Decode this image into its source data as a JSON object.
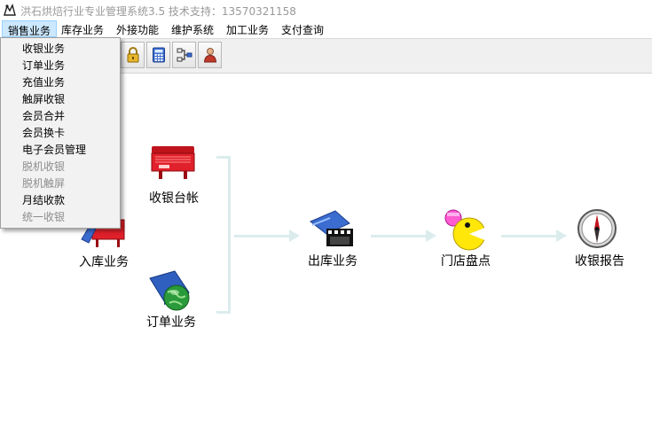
{
  "window": {
    "title": "洪石烘焙行业专业管理系统3.5 技术支持：13570321158"
  },
  "menubar": {
    "items": [
      {
        "label": "销售业务"
      },
      {
        "label": "库存业务"
      },
      {
        "label": "外接功能"
      },
      {
        "label": "维护系统"
      },
      {
        "label": "加工业务"
      },
      {
        "label": "支付查询"
      }
    ]
  },
  "toolbar": {
    "buttons": [
      {
        "icon": "lock-icon"
      },
      {
        "icon": "calculator-icon"
      },
      {
        "icon": "network-icon"
      },
      {
        "icon": "user-icon"
      }
    ]
  },
  "dropdown": {
    "items": [
      {
        "label": "收银业务",
        "enabled": true
      },
      {
        "label": "订单业务",
        "enabled": true
      },
      {
        "label": "充值业务",
        "enabled": true
      },
      {
        "label": "触屏收银",
        "enabled": true
      },
      {
        "label": "会员合并",
        "enabled": true
      },
      {
        "label": "会员换卡",
        "enabled": true
      },
      {
        "label": "电子会员管理",
        "enabled": true
      },
      {
        "label": "脱机收银",
        "enabled": false
      },
      {
        "label": "脱机触屏",
        "enabled": false
      },
      {
        "label": "月结收款",
        "enabled": true
      },
      {
        "label": "统一收银",
        "enabled": false
      }
    ]
  },
  "flow": {
    "cashier_ledger": "收银台帐",
    "inbound": "入库业务",
    "orders": "订单业务",
    "outbound": "出库业务",
    "store_count": "门店盘点",
    "cashier_report": "收银报告"
  },
  "colors": {
    "flow_line": "#dbeced",
    "menu_active": "#cce8ff",
    "disabled_text": "#8d8d8d"
  }
}
